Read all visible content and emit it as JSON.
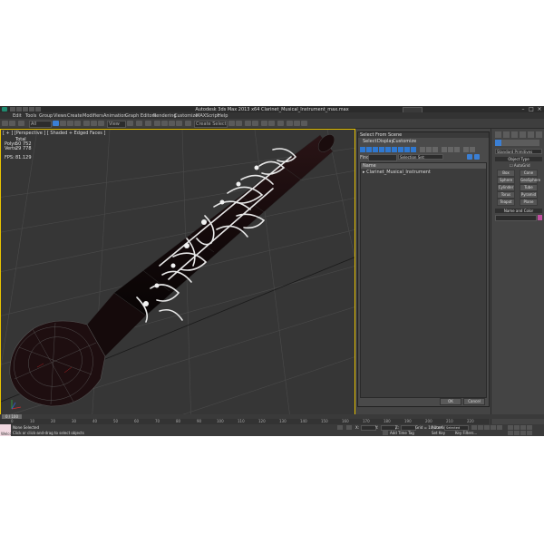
{
  "app": {
    "title": "Autodesk 3ds Max 2013 x64      Clarinet_Musical_Instrument_max.max",
    "search_placeholder": "Type a keyword or phrase",
    "menu": [
      "Edit",
      "Tools",
      "Group",
      "Views",
      "Create",
      "Modifiers",
      "Animation",
      "Graph Editors",
      "Rendering",
      "Customize",
      "MAXScript",
      "Help"
    ]
  },
  "toolbar": {
    "selection_filter": "All",
    "view_mode": "View",
    "named_selection": "Create Selection Set"
  },
  "viewport": {
    "label": "[ + ] [Perspective ] [ Shaded + Edged Faces ]",
    "stats": {
      "header": "Total",
      "polys_label": "Polys:",
      "polys_value": "50 752",
      "verts_label": "Verts:",
      "verts_value": "29 778",
      "fps_label": "FPS:",
      "fps_value": "81.129"
    }
  },
  "dialog": {
    "title": "Select From Scene",
    "tabs": [
      "Select",
      "Display",
      "Customize"
    ],
    "find_label": "Find:",
    "selection_set": "Selection Set:",
    "column_name": "Name",
    "item": "Clarinet_Musical_Instrument",
    "ok": "OK",
    "cancel": "Cancel"
  },
  "command_panel": {
    "dropdown": "Standard Primitives",
    "object_type": "Object Type",
    "autogrid": "AutoGrid",
    "buttons": [
      "Box",
      "Cone",
      "Sphere",
      "GeoSphere",
      "Cylinder",
      "Tube",
      "Torus",
      "Pyramid",
      "Teapot",
      "Plane"
    ],
    "name_and_color": "Name and Color",
    "accent_color": "#c050a0"
  },
  "timeline": {
    "frame_display": "0 / 100",
    "ruler_ticks": [
      "0",
      "10",
      "20",
      "30",
      "40",
      "50",
      "60",
      "70",
      "80",
      "90",
      "100",
      "110",
      "120",
      "130",
      "140",
      "150",
      "160",
      "170",
      "180",
      "190",
      "200",
      "210",
      "220"
    ]
  },
  "status": {
    "selection": "None Selected",
    "prompt": "Click or click-and-drag to select objects",
    "welcome": "Welcome",
    "x_label": "X:",
    "y_label": "Y:",
    "z_label": "Z:",
    "grid": "Grid = 10,0cm",
    "add_time_tag": "Add Time Tag",
    "auto_key": "Auto Key",
    "set_key": "Set Key",
    "selected": "Selected",
    "key_filters": "Key Filters..."
  }
}
